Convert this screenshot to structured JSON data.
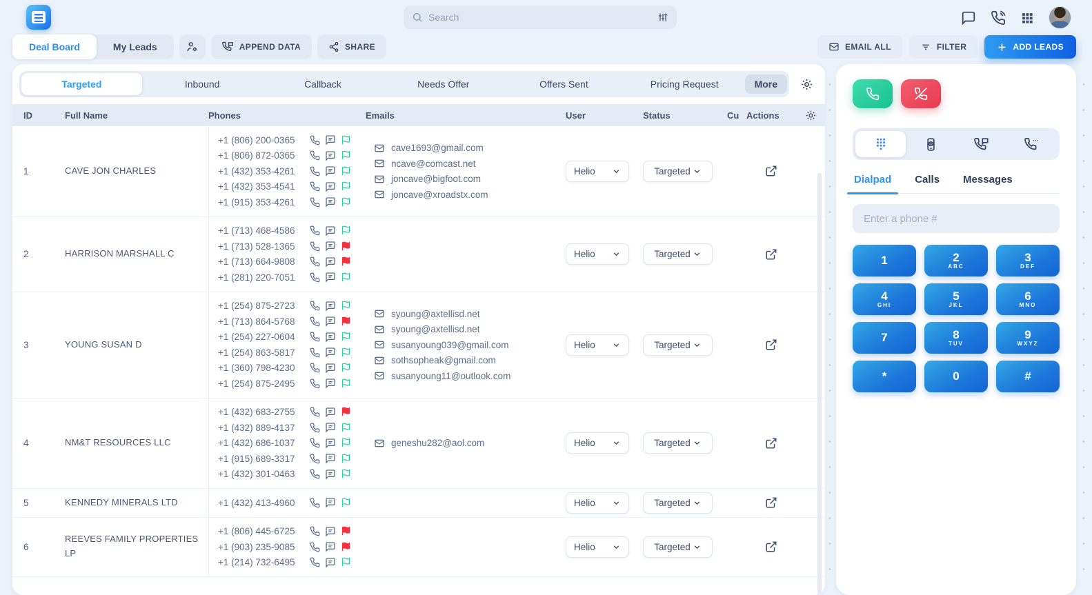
{
  "header": {
    "search_placeholder": "Search",
    "icons": [
      "search-icon",
      "sliders-icon",
      "chat-icon",
      "phone-call-icon",
      "apps-grid-icon",
      "avatar"
    ]
  },
  "toolbar": {
    "tabs": [
      {
        "label": "Deal Board",
        "active": true
      },
      {
        "label": "My Leads",
        "active": false
      }
    ],
    "user_settings_icon": "user-gear-icon",
    "append_data_label": "APPEND DATA",
    "share_label": "SHARE",
    "email_all_label": "EMAIL ALL",
    "filter_label": "FILTER",
    "add_leads_label": "ADD LEADS"
  },
  "board": {
    "tabs": [
      {
        "label": "Targeted",
        "active": true
      },
      {
        "label": "Inbound"
      },
      {
        "label": "Callback"
      },
      {
        "label": "Needs Offer"
      },
      {
        "label": "Offers Sent"
      },
      {
        "label": "Pricing Request"
      },
      {
        "label": "More",
        "muted": true
      }
    ]
  },
  "table": {
    "columns": [
      "ID",
      "Full Name",
      "Phones",
      "Emails",
      "User",
      "Status",
      "Cu",
      "Actions"
    ],
    "rows": [
      {
        "id": "1",
        "name": "CAVE JON CHARLES",
        "phones": [
          {
            "number": "+1 (806) 200-0365",
            "flag": "green"
          },
          {
            "number": "+1 (806) 872-0365",
            "flag": "green"
          },
          {
            "number": "+1 (432) 353-4261",
            "flag": "green"
          },
          {
            "number": "+1 (432) 353-4541",
            "flag": "green"
          },
          {
            "number": "+1 (915) 353-4261",
            "flag": "green"
          }
        ],
        "emails": [
          "cave1693@gmail.com",
          "ncave@comcast.net",
          "joncave@bigfoot.com",
          "joncave@xroadstx.com"
        ],
        "user": "Helio",
        "status": "Targeted"
      },
      {
        "id": "2",
        "name": "HARRISON MARSHALL C",
        "phones": [
          {
            "number": "+1 (713) 468-4586",
            "flag": "green"
          },
          {
            "number": "+1 (713) 528-1365",
            "flag": "red"
          },
          {
            "number": "+1 (713) 664-9808",
            "flag": "red"
          },
          {
            "number": "+1 (281) 220-7051",
            "flag": "green"
          }
        ],
        "emails": [],
        "user": "Helio",
        "status": "Targeted"
      },
      {
        "id": "3",
        "name": "YOUNG SUSAN D",
        "phones": [
          {
            "number": "+1 (254) 875-2723",
            "flag": "green"
          },
          {
            "number": "+1 (713) 864-5768",
            "flag": "red"
          },
          {
            "number": "+1 (254) 227-0604",
            "flag": "green"
          },
          {
            "number": "+1 (254) 863-5817",
            "flag": "green"
          },
          {
            "number": "+1 (360) 798-4230",
            "flag": "green"
          },
          {
            "number": "+1 (254) 875-2495",
            "flag": "green"
          }
        ],
        "emails": [
          "syoung@axtellisd.net",
          "syoung@axtellisd.net",
          "susanyoung039@gmail.com",
          "sothsopheak@gmail.com",
          "susanyoung11@outlook.com"
        ],
        "user": "Helio",
        "status": "Targeted"
      },
      {
        "id": "4",
        "name": "NM&T RESOURCES LLC",
        "phones": [
          {
            "number": "+1 (432) 683-2755",
            "flag": "red"
          },
          {
            "number": "+1 (432) 889-4137",
            "flag": "green"
          },
          {
            "number": "+1 (432) 686-1037",
            "flag": "green"
          },
          {
            "number": "+1 (915) 689-3317",
            "flag": "green"
          },
          {
            "number": "+1 (432) 301-0463",
            "flag": "green"
          }
        ],
        "emails": [
          "geneshu282@aol.com"
        ],
        "user": "Helio",
        "status": "Targeted"
      },
      {
        "id": "5",
        "name": "KENNEDY MINERALS LTD",
        "phones": [
          {
            "number": "+1 (432) 413-4960",
            "flag": "green"
          }
        ],
        "emails": [],
        "user": "Helio",
        "status": "Targeted"
      },
      {
        "id": "6",
        "name": "REEVES FAMILY PROPERTIES LP",
        "phones": [
          {
            "number": "+1 (806) 445-6725",
            "flag": "red"
          },
          {
            "number": "+1 (903) 235-9085",
            "flag": "red"
          },
          {
            "number": "+1 (214) 732-6495",
            "flag": "green"
          }
        ],
        "emails": [],
        "user": "Helio",
        "status": "Targeted"
      }
    ]
  },
  "dialer": {
    "tabs": [
      "Dialpad",
      "Calls",
      "Messages"
    ],
    "active_tab": "Dialpad",
    "input_placeholder": "Enter a phone #",
    "keys": [
      {
        "digit": "1",
        "letters": ""
      },
      {
        "digit": "2",
        "letters": "ABC"
      },
      {
        "digit": "3",
        "letters": "DEF"
      },
      {
        "digit": "4",
        "letters": "GHI"
      },
      {
        "digit": "5",
        "letters": "JKL"
      },
      {
        "digit": "6",
        "letters": "MNO"
      },
      {
        "digit": "7",
        "letters": ""
      },
      {
        "digit": "8",
        "letters": "TUV"
      },
      {
        "digit": "9",
        "letters": "WXYZ"
      },
      {
        "digit": "*",
        "letters": ""
      },
      {
        "digit": "0",
        "letters": ""
      },
      {
        "digit": "#",
        "letters": ""
      }
    ]
  },
  "colors": {
    "accent_blue": "#2f8ceb",
    "key_gradient_start": "#33a8e5",
    "key_gradient_end": "#1565d2",
    "green_flag": "#2cd0a0",
    "red_flag": "#f4303e",
    "call_green": "#19c18f",
    "hangup_red": "#e93a52",
    "page_background": "#ecf2fa"
  }
}
